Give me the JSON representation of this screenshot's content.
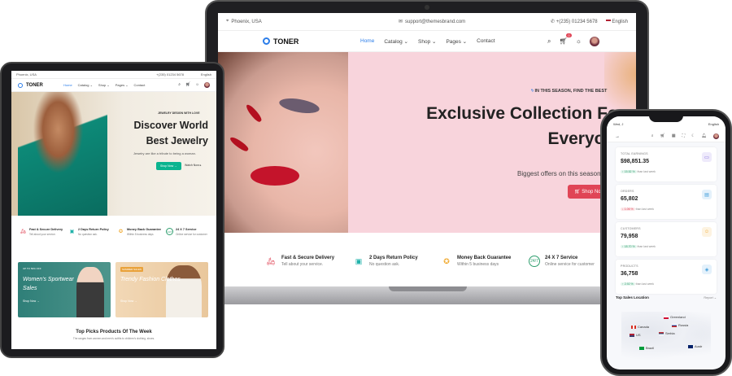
{
  "laptop": {
    "topbar": {
      "location": "Phoenix, USA",
      "email": "support@themesbrand.com",
      "phone": "+(235) 01234 5678",
      "language": "English"
    },
    "brand": "TONER",
    "menu": [
      {
        "label": "Home"
      },
      {
        "label": "Catalog ⌄"
      },
      {
        "label": "Shop ⌄"
      },
      {
        "label": "Pages ⌄"
      },
      {
        "label": "Contact"
      }
    ],
    "cart_count": "0",
    "hero": {
      "tag": "IN THIS SEASON, FIND THE BEST",
      "title_line1": "Exclusive Collection For",
      "title_line2": "Everyone",
      "subtitle": "Biggest offers on this season",
      "button": "Shop Now"
    },
    "features": [
      {
        "title": "Fast & Secure Delivery",
        "sub": "Tell about your service.",
        "icon": "delivery-icon",
        "color": "#e04556"
      },
      {
        "title": "2 Days Return Policy",
        "sub": "No question ask.",
        "icon": "box-return-icon",
        "color": "#20b2aa"
      },
      {
        "title": "Money Back Guarantee",
        "sub": "Within 5 business days",
        "icon": "medal-icon",
        "color": "#f0a92e"
      },
      {
        "title": "24 X 7 Service",
        "sub": "Online service for customer",
        "icon": "support-247-icon",
        "color": "#2f9e6e"
      }
    ]
  },
  "tablet": {
    "topbar": {
      "location": "Phoenix, USA",
      "phone": "+(235) 01234 5678",
      "language": "English"
    },
    "brand": "TONER",
    "menu": [
      {
        "label": "Home"
      },
      {
        "label": "Catalog ⌄"
      },
      {
        "label": "Shop ⌄"
      },
      {
        "label": "Pages ⌄"
      },
      {
        "label": "Contact"
      }
    ],
    "hero": {
      "tag": "JEWELRY DESIGN WITH LOVE",
      "title_line1": "Discover World",
      "title_line2": "Best Jewelry",
      "subtitle": "Jewelry are like a tribute to being a woman.",
      "button": "Shop Now →",
      "link": "Watch Now ▸"
    },
    "features": [
      {
        "title": "Fast & Secure Delivery",
        "sub": "Tell about your service."
      },
      {
        "title": "2 Days Return Policy",
        "sub": "No question ask."
      },
      {
        "title": "Money Back Guarantee",
        "sub": "Within 5 business days"
      },
      {
        "title": "24 X 7 Service",
        "sub": "Online service for customer"
      }
    ],
    "banners": [
      {
        "small": "UP TO 50% OFF",
        "title": "Women's Sportwear Sales",
        "link": "Shop Now →"
      },
      {
        "small": "SUMMER SALES",
        "title": "Trendy Fashion Clothes",
        "link": "Shop Now →"
      }
    ],
    "section_title": "Top Picks Products Of The Week",
    "section_sub": "The ranges from women and men's outfits to children's clothing, shoes."
  },
  "phone": {
    "topbar": {
      "date": "Wed, J",
      "lang": "English"
    },
    "cards": [
      {
        "label": "TOTAL EARNINGS",
        "value": "$98,851.35",
        "change": "↑ 15.52 %",
        "note": "than last week",
        "color": "#2f9e6e",
        "bg": "#e5f5ee",
        "icon_color": "#6f57d8",
        "icon_bg": "#eeeafb"
      },
      {
        "label": "ORDERS",
        "value": "65,802",
        "change": "↓ 1.06 %",
        "note": "than last week",
        "color": "#e04556",
        "bg": "#fbe6e8",
        "icon_color": "#3a9ad9",
        "icon_bg": "#e4f1fb"
      },
      {
        "label": "CUSTOMERS",
        "value": "79,958",
        "change": "↑ 18.70 %",
        "note": "than last week",
        "color": "#2f9e6e",
        "bg": "#e5f5ee",
        "icon_color": "#f0a92e",
        "icon_bg": "#fdf3e1"
      },
      {
        "label": "PRODUCTS",
        "value": "36,758",
        "change": "↑ 2.92 %",
        "note": "than last week",
        "color": "#2f9e6e",
        "bg": "#e5f5ee",
        "icon_color": "#3a9ad9",
        "icon_bg": "#e4f1fb"
      }
    ],
    "section": "Top Sales Location",
    "report": "Report ⌄",
    "pins": [
      {
        "label": "Greenland"
      },
      {
        "label": "Canada"
      },
      {
        "label": "Russia"
      },
      {
        "label": "US"
      },
      {
        "label": "Serbia"
      },
      {
        "label": "Brazil"
      },
      {
        "label": "Austr"
      }
    ]
  }
}
